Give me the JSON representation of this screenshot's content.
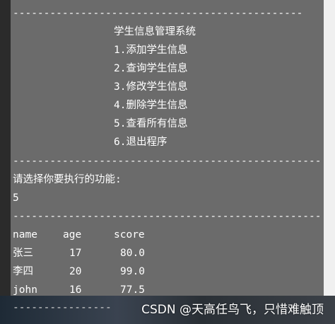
{
  "terminal": {
    "separator_top": "-----------------------------------------------",
    "menu": {
      "title": "学生信息管理系统",
      "items": [
        "1.添加学生信息",
        "2.查询学生信息",
        "3.修改学生信息",
        "4.删除学生信息",
        "5.查看所有信息",
        "6.退出程序"
      ]
    },
    "separator_mid": "--------------------------------------------------",
    "prompt": "请选择你要执行的功能:",
    "input_value": "5",
    "separator_table": "--------------------------------------------------",
    "table": {
      "headers": [
        "name",
        "age",
        "score"
      ],
      "rows": [
        [
          "张三",
          "17",
          "80.0"
        ],
        [
          "李四",
          "20",
          "99.0"
        ],
        [
          "john",
          "16",
          "77.5"
        ]
      ]
    },
    "separator_bottom": "----------------"
  },
  "watermark": "CSDN @天高任鸟飞，只惜难触顶",
  "colors": {
    "terminal_bg": "#6b6b6b",
    "text": "#ffffff"
  }
}
